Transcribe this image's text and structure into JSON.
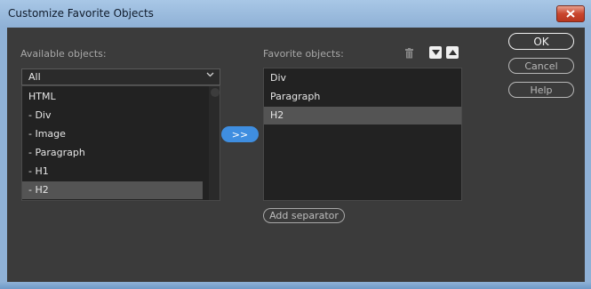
{
  "window": {
    "title": "Customize Favorite Objects",
    "close_icon": "close-x-icon",
    "close_color": "#c9452d"
  },
  "available": {
    "label": "Available objects:",
    "filter_value": "All",
    "items": [
      "HTML",
      "- Div",
      "- Image",
      "- Paragraph",
      "- H1",
      "- H2"
    ],
    "selected_index": 5
  },
  "add_button": {
    "label": ">>",
    "color": "#3f8ee0"
  },
  "favorites": {
    "label": "Favorite objects:",
    "items": [
      "Div",
      "Paragraph",
      "H2"
    ],
    "selected_index": 2,
    "icons": {
      "delete": "trash-icon",
      "move_down": "triangle-down-icon",
      "move_up": "triangle-up-icon"
    }
  },
  "add_separator": {
    "label": "Add separator"
  },
  "buttons": {
    "ok": "OK",
    "cancel": "Cancel",
    "help": "Help"
  }
}
